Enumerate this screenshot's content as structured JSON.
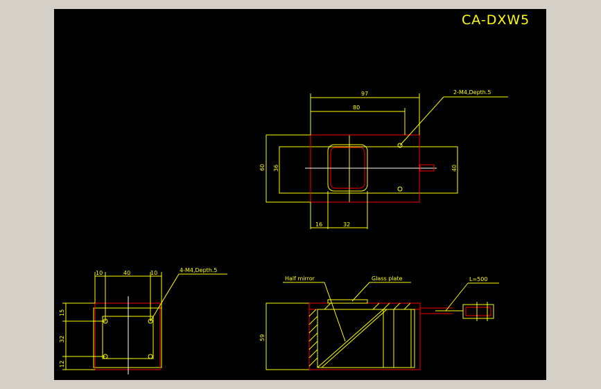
{
  "drawing": {
    "title": "CA-DXW5",
    "colors": {
      "background": "#000000",
      "frame": "#d4d0c8",
      "dimension": "#ffff00",
      "outline": "#ff0000",
      "center": "#ffffff"
    }
  },
  "top_view": {
    "dim_overall_width": "97",
    "dim_inner_width": "80",
    "dim_overall_height": "60",
    "dim_window_height": "36",
    "dim_right_height": "40",
    "dim_left_offset": "16",
    "dim_window_width": "32",
    "callout_holes": "2-M4,Depth.5"
  },
  "side_view": {
    "dim_top_left": "10",
    "dim_top_middle": "40",
    "dim_top_right": "10",
    "dim_left_top": "15",
    "dim_left_middle": "32",
    "dim_left_bottom": "12",
    "callout_holes": "4-M4,Depth.5"
  },
  "section_view": {
    "label_half_mirror": "Half mirror",
    "label_glass_plate": "Glass plate",
    "label_cable": "L=500",
    "dim_height": "59"
  }
}
